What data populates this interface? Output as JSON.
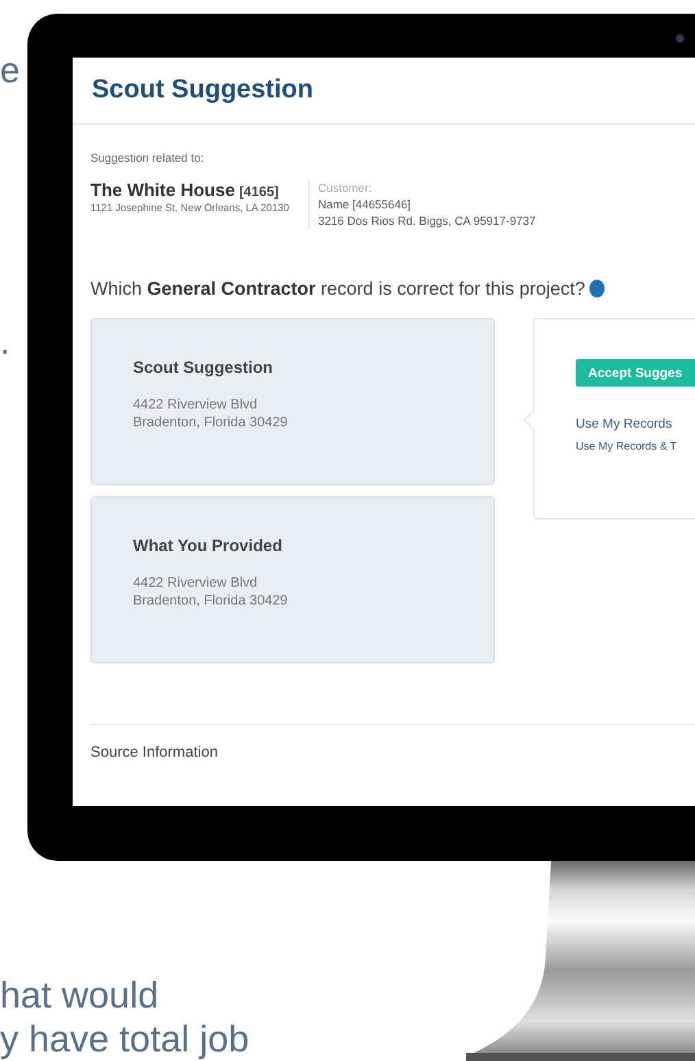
{
  "side_text": {
    "top_fragment": "e",
    "middle_fragment": "."
  },
  "screen": {
    "title": "Scout Suggestion",
    "related": {
      "label": "Suggestion related to:",
      "project_name": "The White House",
      "project_id": "[4165]",
      "project_address": "1121 Josephine St. New Orleans, LA 20130",
      "customer_label": "Customer:",
      "customer_name": "Name [44655646]",
      "customer_address": "3216 Dos Rios Rd. Biggs, CA 95917-9737"
    },
    "question": "Which **General Contractor** record is correct for this project?",
    "cards": [
      {
        "title": "Scout Suggestion",
        "address_line_1": "4422 Riverview Blvd",
        "address_line_2": "Bradenton, Florida 30429"
      },
      {
        "title": "What You Provided",
        "address_line_1": "4422 Riverview Blvd",
        "address_line_2": "Bradenton, Florida 30429"
      }
    ],
    "actions": {
      "primary": "Accept Sugges",
      "links": [
        "Use My Records",
        "Use My Records & T"
      ]
    },
    "section_heading": "Source Information"
  },
  "caption": [
    "hat would",
    "y have total job"
  ]
}
